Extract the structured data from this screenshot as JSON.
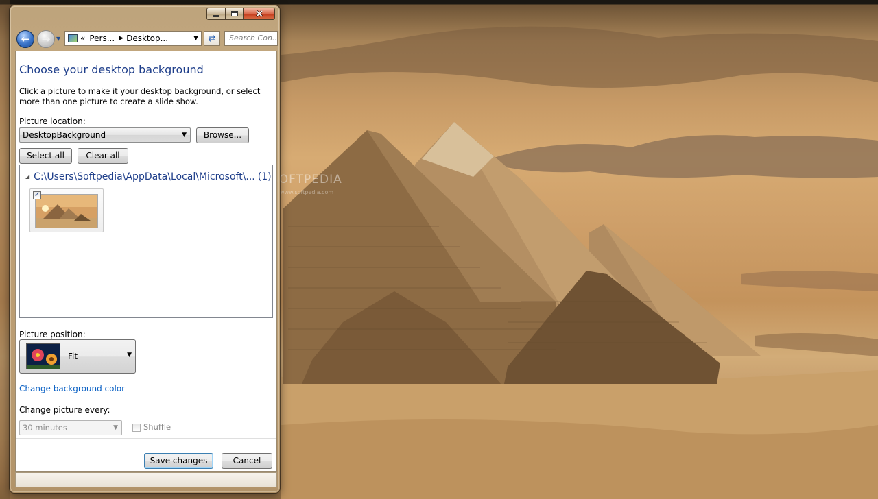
{
  "desktop": {
    "watermark": "SOFTPEDIA",
    "watermark_sub": "www.softpedia.com"
  },
  "window": {
    "caption_buttons": [
      "minimize-icon",
      "maximize-icon",
      "close-icon"
    ]
  },
  "nav": {
    "back_icon": "back-arrow-icon",
    "forward_icon": "forward-arrow-icon",
    "address": {
      "prefix": "«",
      "segments": [
        "Pers...",
        "Desktop..."
      ]
    },
    "refresh_icon": "refresh-icon",
    "search_placeholder": "Search Con..."
  },
  "page": {
    "title": "Choose your desktop background",
    "description": "Click a picture to make it your desktop background, or select more than one picture to create a slide show.",
    "picture_location_label": "Picture location:",
    "picture_location_value": "DesktopBackground",
    "browse_label": "Browse...",
    "select_all_label": "Select all",
    "clear_all_label": "Clear all",
    "group_path": "C:\\Users\\Softpedia\\AppData\\Local\\Microsoft\\...",
    "group_count": "(1)",
    "picture_checked": true,
    "picture_position_label": "Picture position:",
    "picture_position_value": "Fit",
    "change_bg_color_link": "Change background color",
    "change_every_label": "Change picture every:",
    "change_every_value": "30 minutes",
    "shuffle_label": "Shuffle",
    "shuffle_checked": false,
    "save_label": "Save changes",
    "cancel_label": "Cancel"
  },
  "colors": {
    "title_blue": "#1e3e8a",
    "link_blue": "#0b61c4",
    "window_frame": "#c4aa82"
  }
}
